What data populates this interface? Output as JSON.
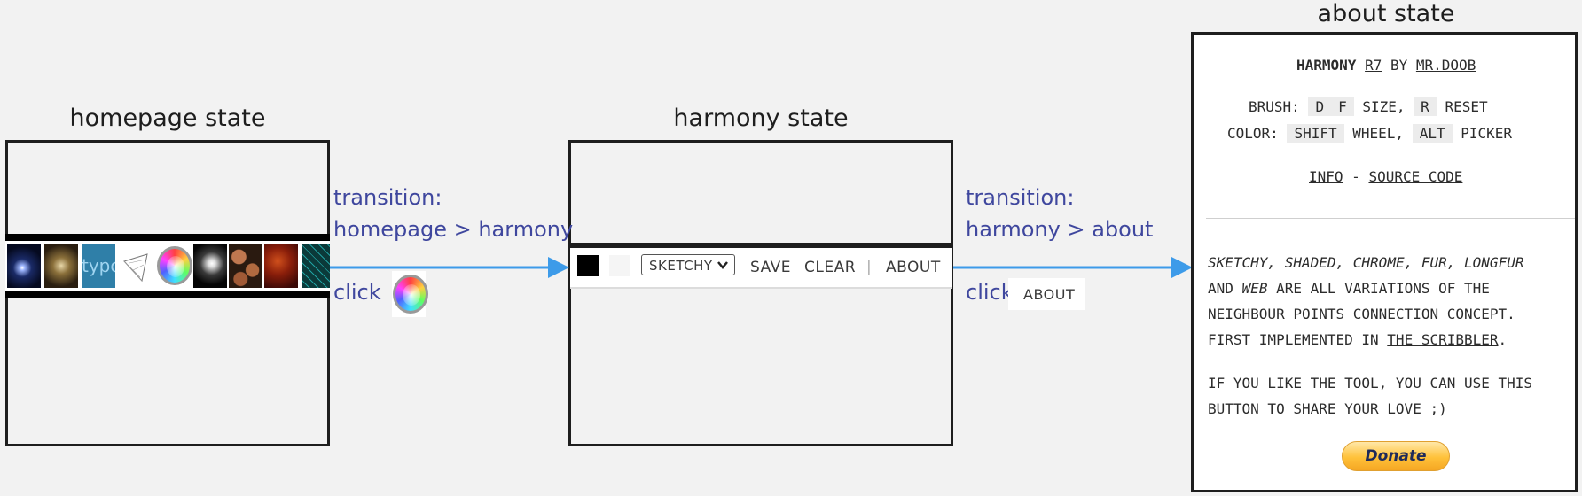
{
  "states": {
    "homepage": {
      "title": "homepage state"
    },
    "harmony": {
      "title": "harmony state"
    },
    "about": {
      "title": "about state"
    }
  },
  "transitions": {
    "t1": {
      "line1": "transition:",
      "line2": "homepage > harmony",
      "click_label": "click",
      "click_target_icon": "color-wheel-icon"
    },
    "t2": {
      "line1": "transition:",
      "line2": "harmony > about",
      "click_label": "click",
      "click_target_label": "ABOUT"
    }
  },
  "homepage": {
    "thumbnails": [
      "glow-orb-thumb",
      "swirl-thumb",
      "type-thumb",
      "mesh-thumb",
      "color-wheel-icon",
      "light-orb-thumb",
      "stones-thumb",
      "fire-thumb",
      "grid-thumb"
    ],
    "thumb_type_text": "typo"
  },
  "harmony": {
    "toolbar": {
      "brush_select": "SKETCHY",
      "save": "SAVE",
      "clear": "CLEAR",
      "separator": "|",
      "about": "ABOUT"
    },
    "colors": {
      "foreground": "#000000",
      "background": "#f5f5f5"
    }
  },
  "about": {
    "header": {
      "name": "HARMONY",
      "version": "R7",
      "by": "BY",
      "author": "MR.DOOB"
    },
    "brush_line": {
      "label": "BRUSH:",
      "key1": "D",
      "key2": "F",
      "size": "SIZE,",
      "key3": "R",
      "reset": "RESET"
    },
    "color_line": {
      "label": "COLOR:",
      "key1": "SHIFT",
      "wheel": "WHEEL,",
      "key2": "ALT",
      "picker": "PICKER"
    },
    "links": {
      "info": "INFO",
      "dash": "-",
      "source": "SOURCE CODE"
    },
    "desc": {
      "b1": "SKETCHY,",
      "b2": "SHADED,",
      "b3": "CHROME,",
      "b4": "FUR,",
      "b5": "LONGFUR",
      "and": "AND",
      "web": "WEB",
      "rest1": "ARE ALL VARIATIONS OF THE",
      "line3": "NEIGHBOUR POINTS CONNECTION CONCEPT.",
      "line4a": "FIRST IMPLEMENTED IN",
      "line4b": "THE SCRIBBLER",
      "line4c": "."
    },
    "share": {
      "line1": "IF YOU LIKE THE TOOL, YOU CAN USE THIS",
      "line2": "BUTTON TO SHARE YOUR LOVE ;)"
    },
    "donate": "Donate"
  },
  "colors": {
    "arrow": "#3d9be9",
    "label": "#3f479e",
    "frame": "#1e1e1e"
  }
}
